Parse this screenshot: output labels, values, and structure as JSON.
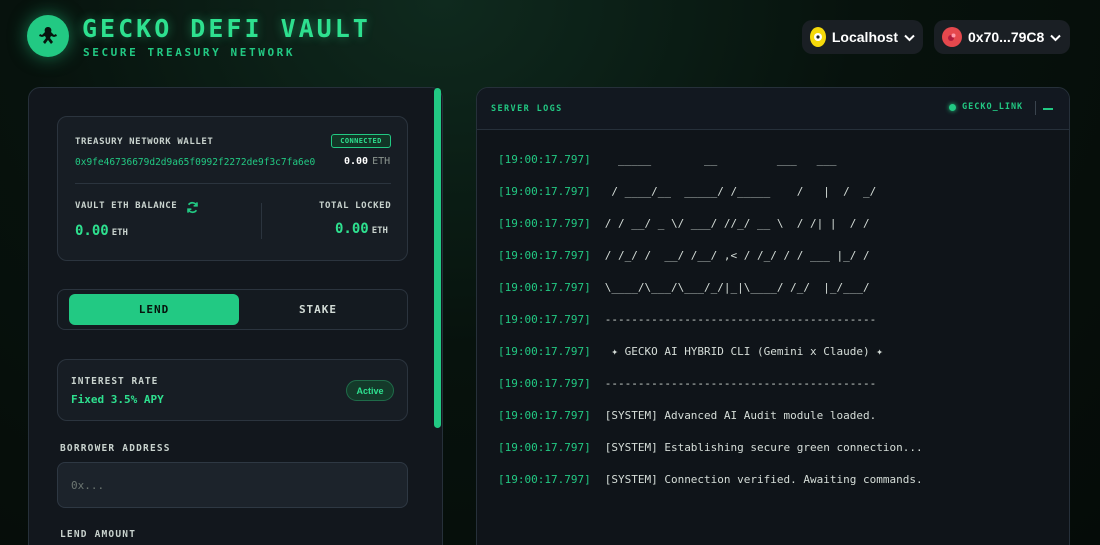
{
  "header": {
    "title": "GECKO DEFI VAULT",
    "subtitle": "SECURE TREASURY NETWORK",
    "logo_icon": "gecko-icon",
    "network": {
      "label": "Localhost",
      "icon": "network-icon",
      "color": "#f5d90a"
    },
    "account": {
      "label": "0x70...79C8",
      "icon": "account-avatar-icon",
      "color": "#e5484d"
    }
  },
  "wallet_card": {
    "label": "TREASURY NETWORK WALLET",
    "status": "CONNECTED",
    "address": "0x9fe46736679d2d9a65f0992f2272de9f3c7fa6e0",
    "eth_value": "0.00",
    "eth_unit": "ETH",
    "vault_label": "VAULT ETH BALANCE",
    "vault_value": "0.00",
    "vault_unit": "ETH",
    "locked_label": "TOTAL LOCKED",
    "locked_value": "0.00",
    "locked_unit": "ETH"
  },
  "tabs": [
    {
      "label": "LEND",
      "active": true
    },
    {
      "label": "STAKE",
      "active": false
    }
  ],
  "interest": {
    "label": "INTEREST RATE",
    "value": "Fixed 3.5% APY",
    "status": "Active"
  },
  "borrower": {
    "label": "BORROWER ADDRESS",
    "placeholder": "0x..."
  },
  "lend_amount": {
    "label": "LEND AMOUNT"
  },
  "logs": {
    "title": "SERVER LOGS",
    "link_label": "GECKO_LINK",
    "lines": [
      {
        "ts": "[19:00:17.797]",
        "msg": "  _____        __         ___   ___"
      },
      {
        "ts": "[19:00:17.797]",
        "msg": " / ____/__  _____/ /_____    /   |  /  _/"
      },
      {
        "ts": "[19:00:17.797]",
        "msg": "/ / __/ _ \\/ ___/ //_/ __ \\  / /| |  / /"
      },
      {
        "ts": "[19:00:17.797]",
        "msg": "/ /_/ /  __/ /__/ ,< / /_/ / / ___ |_/ /"
      },
      {
        "ts": "[19:00:17.797]",
        "msg": "\\____/\\___/\\___/_/|_|\\____/ /_/  |_/___/"
      },
      {
        "ts": "[19:00:17.797]",
        "msg": "-----------------------------------------"
      },
      {
        "ts": "[19:00:17.797]",
        "msg": " ✦ GECKO AI HYBRID CLI (Gemini x Claude) ✦"
      },
      {
        "ts": "[19:00:17.797]",
        "msg": "-----------------------------------------"
      },
      {
        "ts": "[19:00:17.797]",
        "msg": "[SYSTEM] Advanced AI Audit module loaded."
      },
      {
        "ts": "[19:00:17.797]",
        "msg": "[SYSTEM] Establishing secure green connection..."
      },
      {
        "ts": "[19:00:17.797]",
        "msg": "[SYSTEM] Connection verified. Awaiting commands."
      }
    ]
  }
}
